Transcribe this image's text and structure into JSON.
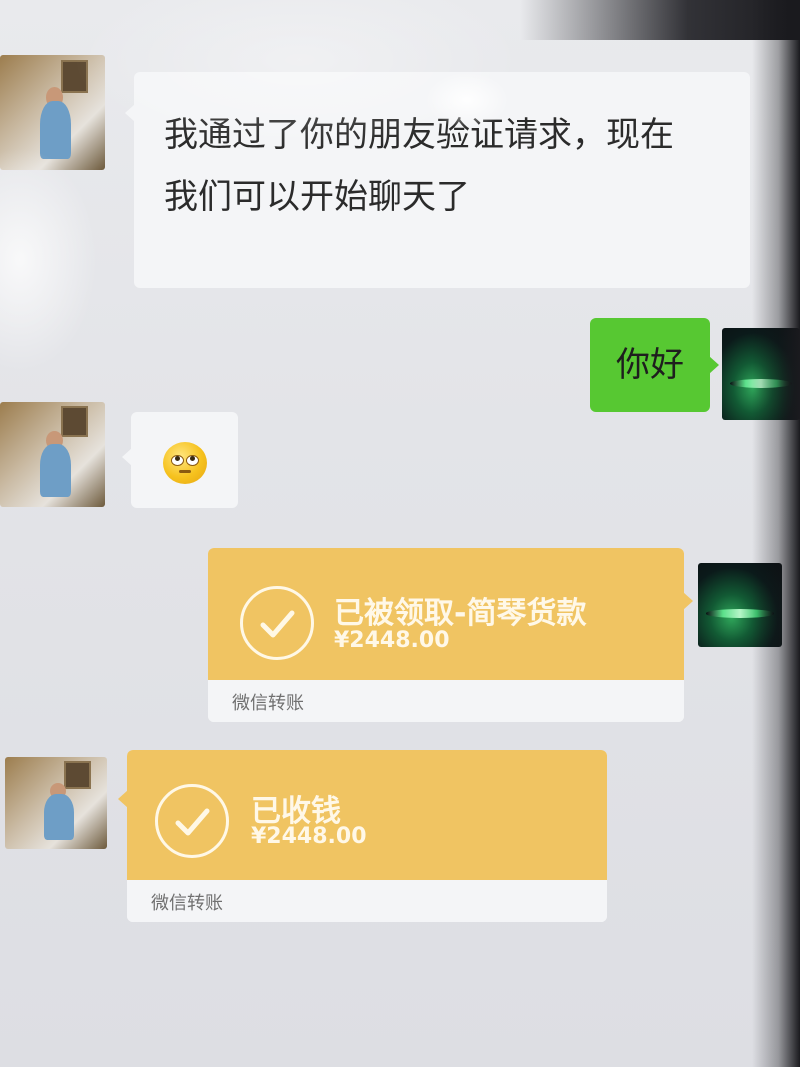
{
  "chat": {
    "messages": [
      {
        "sender": "friend",
        "type": "text",
        "lines": [
          "我通过了你的朋友验证请求，现在",
          "我们可以开始聊天了"
        ]
      },
      {
        "sender": "self",
        "type": "text",
        "text": "你好"
      },
      {
        "sender": "friend",
        "type": "emoji",
        "emoji": "smiley-emoji"
      },
      {
        "sender": "self",
        "type": "transfer",
        "title": "已被领取-简琴货款",
        "amount": "¥2448.00",
        "footer": "微信转账"
      },
      {
        "sender": "friend",
        "type": "transfer",
        "title": "已收钱",
        "amount": "¥2448.00",
        "footer": "微信转账"
      }
    ]
  },
  "colors": {
    "background": "#e5e6ea",
    "bubble_white": "#f4f5f7",
    "bubble_green": "#57c832",
    "transfer_gold": "#f0c462"
  },
  "icons": {
    "transfer_check": "check-circle-icon"
  }
}
